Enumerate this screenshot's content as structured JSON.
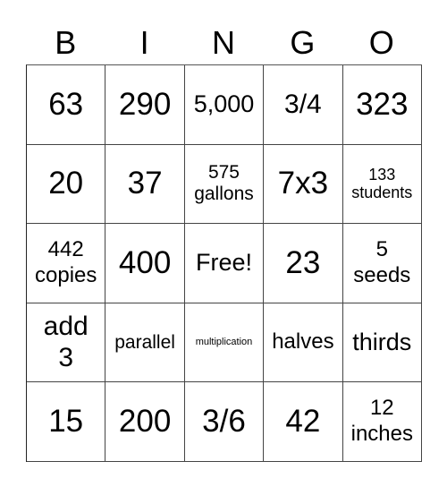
{
  "header": {
    "letters": [
      "B",
      "I",
      "N",
      "G",
      "O"
    ]
  },
  "card": {
    "rows": [
      [
        "63",
        "290",
        "5,000",
        "3/4",
        "323"
      ],
      [
        "20",
        "37",
        "575\ngallons",
        "7x3",
        "133\nstudents"
      ],
      [
        "442\ncopies",
        "400",
        "Free!",
        "23",
        "5\nseeds"
      ],
      [
        "add\n3",
        "parallel",
        "multiplication",
        "halves",
        "thirds"
      ],
      [
        "15",
        "200",
        "3/6",
        "42",
        "12\ninches"
      ]
    ]
  }
}
